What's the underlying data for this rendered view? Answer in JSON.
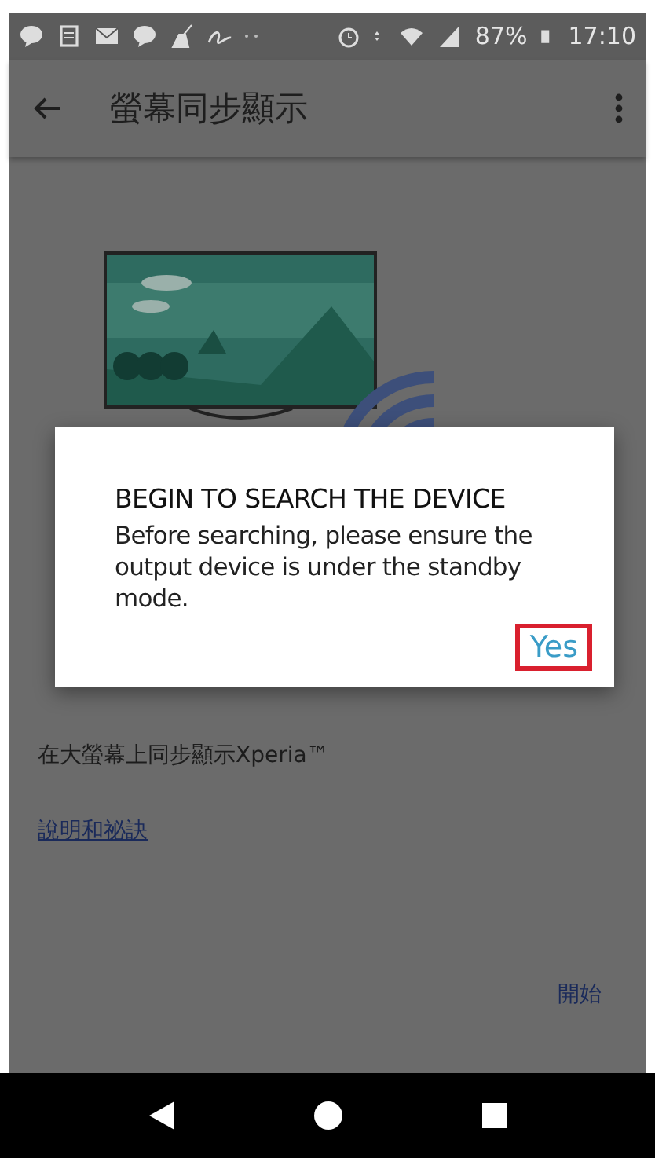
{
  "status_bar": {
    "battery": "87%",
    "time": "17:10"
  },
  "app_bar": {
    "title": "螢幕同步顯示"
  },
  "content": {
    "description": "在大螢幕上同步顯示Xperia™",
    "help_link": "說明和祕訣",
    "start_button": "開始"
  },
  "dialog": {
    "title": "BEGIN TO SEARCH THE DEVICE",
    "message": "Before searching, please ensure the output device is under the standby mode.",
    "confirm_button": {
      "label": "Yes",
      "highlighted": true
    }
  }
}
